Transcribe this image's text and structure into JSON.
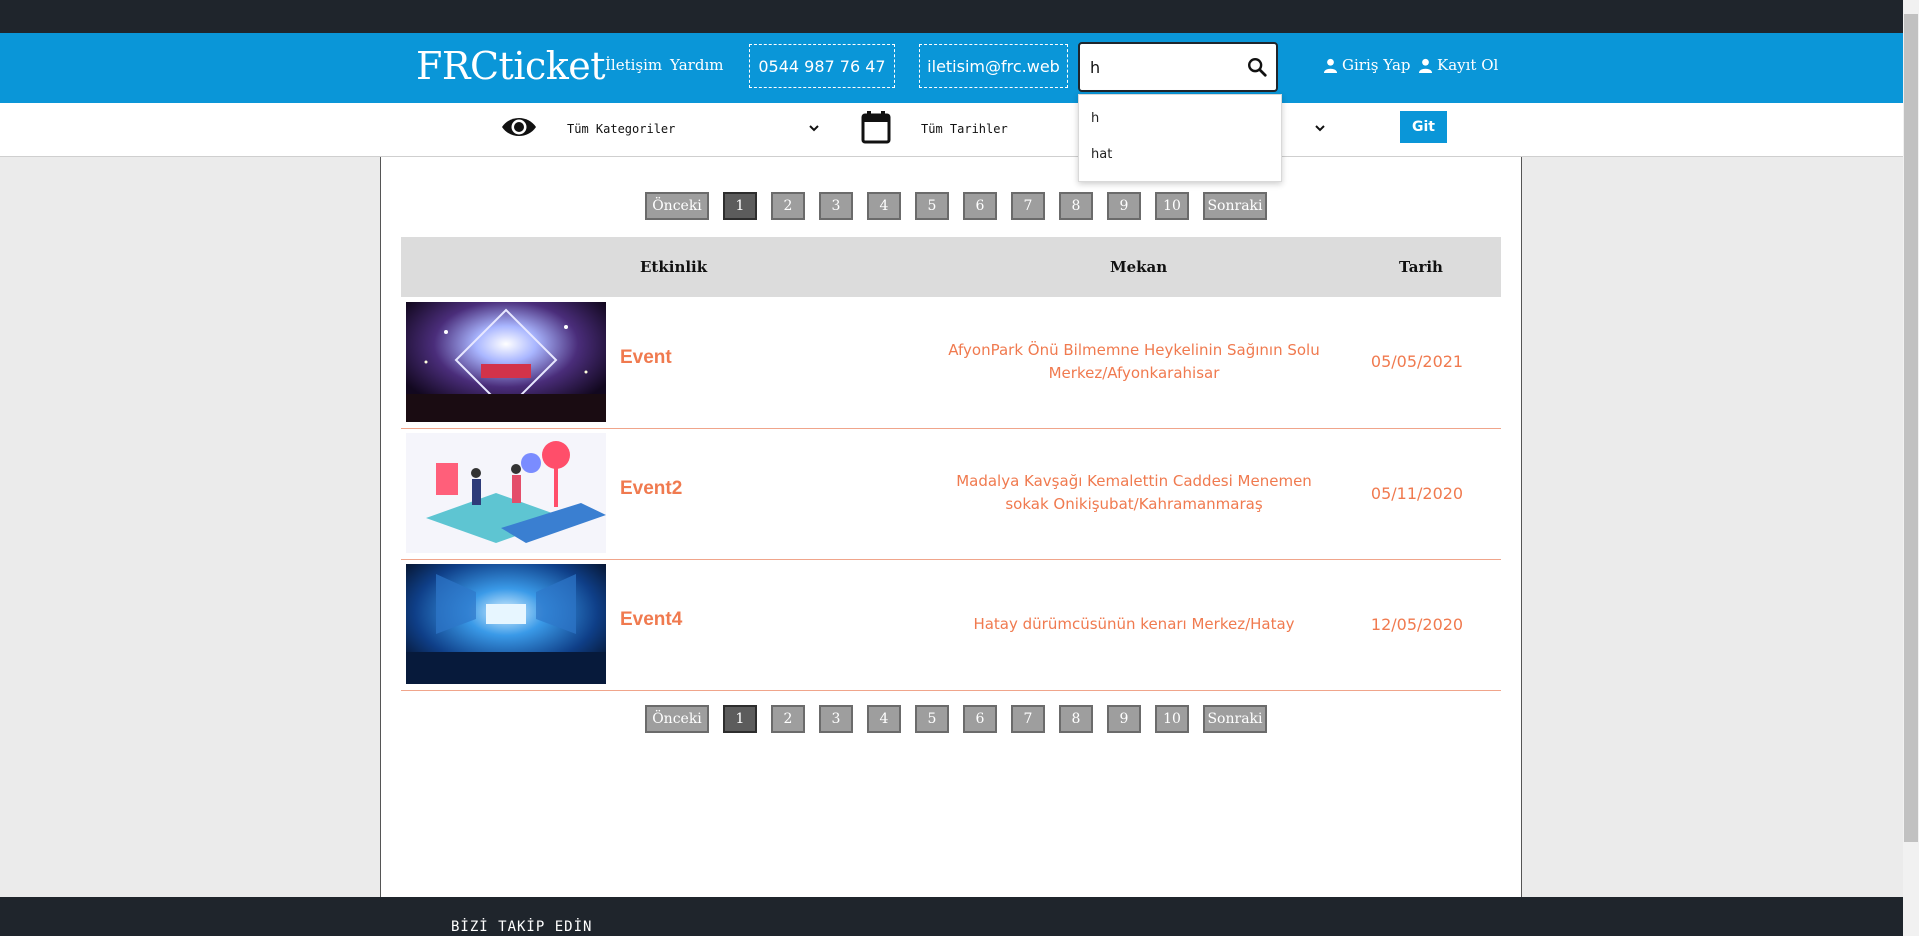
{
  "header": {
    "logo": "FRCticket",
    "nav": [
      "İletişim",
      "Yardım"
    ],
    "phone": "0544 987 76 47",
    "email": "iletisim@frc.web",
    "search": {
      "value": "h",
      "icon": "search-icon"
    },
    "login_label": "Giriş Yap",
    "register_label": "Kayıt Ol"
  },
  "search_suggestions": [
    "h",
    "hat"
  ],
  "filters": {
    "category_icon": "eye-icon",
    "category": "Tüm Kategoriler",
    "date_icon": "calendar-icon",
    "date": "Tüm Tarihler",
    "go_label": "Git"
  },
  "pagination": {
    "prev": "Önceki",
    "next": "Sonraki",
    "pages": [
      "1",
      "2",
      "3",
      "4",
      "5",
      "6",
      "7",
      "8",
      "9",
      "10"
    ],
    "current": "1"
  },
  "table": {
    "headers": [
      "Etkinlik",
      "Mekan",
      "Tarih"
    ],
    "rows": [
      {
        "title": "Event",
        "venue": "AfyonPark Önü Bilmemne Heykelinin Sağının Solu Merkez/Afyonkarahisar",
        "date": "05/05/2021"
      },
      {
        "title": "Event2",
        "venue": "Madalya Kavşağı Kemalettin Caddesi Menemen sokak Onikişubat/Kahramanmaraş",
        "date": "05/11/2020"
      },
      {
        "title": "Event4",
        "venue": "Hatay dürümcüsünün kenarı Merkez/Hatay",
        "date": "12/05/2020"
      }
    ]
  },
  "footer": {
    "follow": "BİZİ TAKİP EDİN"
  },
  "colors": {
    "brand": "#0a96d8",
    "dark": "#1f252c",
    "accent": "#f07a4f"
  }
}
